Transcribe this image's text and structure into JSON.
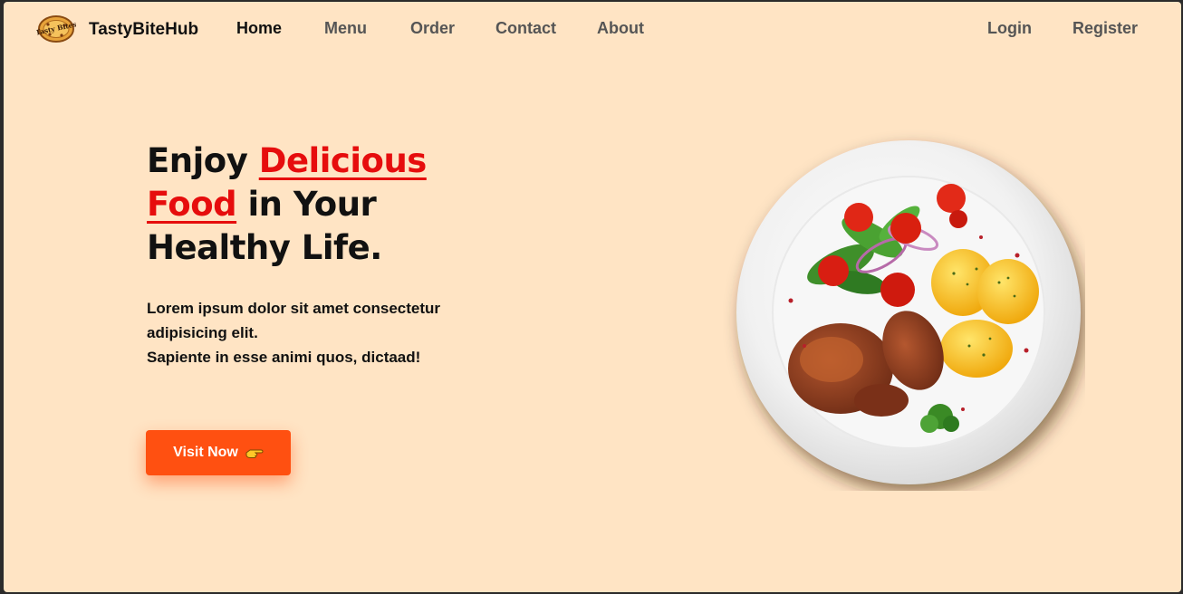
{
  "nav": {
    "logo_text": "Tasty Bites",
    "brand": "TastyBiteHub",
    "links": [
      "Home",
      "Menu",
      "Order",
      "Contact",
      "About"
    ],
    "active": "Home",
    "auth": {
      "login": "Login",
      "register": "Register"
    }
  },
  "hero": {
    "title_pre": "Enjoy",
    "title_hl1": "Delicious",
    "title_hl2": "Food",
    "title_mid": "in Your",
    "title_end": "Healthy Life.",
    "text_line1": "Lorem ipsum dolor sit amet consectetur",
    "text_line2": "adipisicing elit.",
    "text_line3": "Sapiente in esse animi quos, dictaad!",
    "button_label": "Visit Now",
    "image_alt": "plate of grilled meat with salad and potatoes"
  },
  "colors": {
    "background": "#ffe4c4",
    "accent_red": "#e60d0d",
    "button": "#ff5011"
  },
  "icons": [
    "logo-icon",
    "pointing-hand-icon"
  ]
}
